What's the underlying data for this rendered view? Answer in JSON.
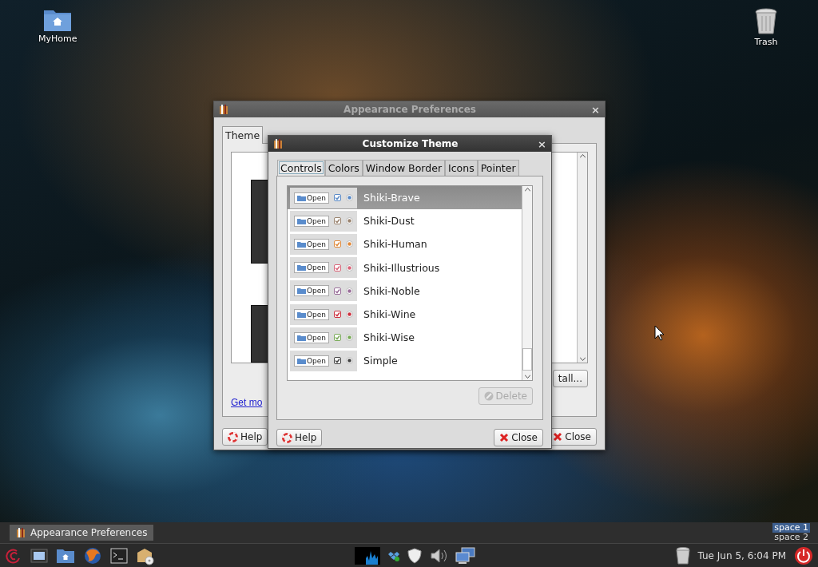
{
  "desktop_icons": [
    {
      "label": "MyHome",
      "kind": "folder"
    },
    {
      "label": "Trash",
      "kind": "trash"
    }
  ],
  "appearance_window": {
    "title": "Appearance Preferences",
    "close": "×",
    "tabs": [
      {
        "label": "Theme",
        "selected": true
      }
    ],
    "link": "Get mo",
    "install_button": "tall...",
    "help_button": "Help",
    "close_button": "Close"
  },
  "customize_dialog": {
    "title": "Customize Theme",
    "close": "×",
    "tabs": [
      {
        "label": "Controls",
        "selected": true
      },
      {
        "label": "Colors",
        "selected": false
      },
      {
        "label": "Window Border",
        "selected": false
      },
      {
        "label": "Icons",
        "selected": false
      },
      {
        "label": "Pointer",
        "selected": false
      }
    ],
    "themes": [
      {
        "name": "Shiki-Brave",
        "sample_button": "Open",
        "color": "#5b8ac6",
        "selected": true
      },
      {
        "name": "Shiki-Dust",
        "sample_button": "Open",
        "color": "#9a8470",
        "selected": false
      },
      {
        "name": "Shiki-Human",
        "sample_button": "Open",
        "color": "#e08a3c",
        "selected": false
      },
      {
        "name": "Shiki-Illustrious",
        "sample_button": "Open",
        "color": "#d9667a",
        "selected": false
      },
      {
        "name": "Shiki-Noble",
        "sample_button": "Open",
        "color": "#9a6f9a",
        "selected": false
      },
      {
        "name": "Shiki-Wine",
        "sample_button": "Open",
        "color": "#cc3340",
        "selected": false
      },
      {
        "name": "Shiki-Wise",
        "sample_button": "Open",
        "color": "#7aaa5a",
        "selected": false
      },
      {
        "name": "Simple",
        "sample_button": "Open",
        "color": "#444444",
        "selected": false
      }
    ],
    "delete_button": {
      "label": "Delete",
      "disabled": true
    },
    "help_button": "Help",
    "close_button": "Close"
  },
  "taskbar": {
    "tasks": [
      {
        "label": "Appearance Preferences",
        "selected": true
      }
    ],
    "workspaces": [
      {
        "label": "space 1",
        "selected": true
      },
      {
        "label": "space 2",
        "selected": false
      }
    ]
  },
  "panel": {
    "clock": "Tue Jun  5, 6:04 PM"
  }
}
